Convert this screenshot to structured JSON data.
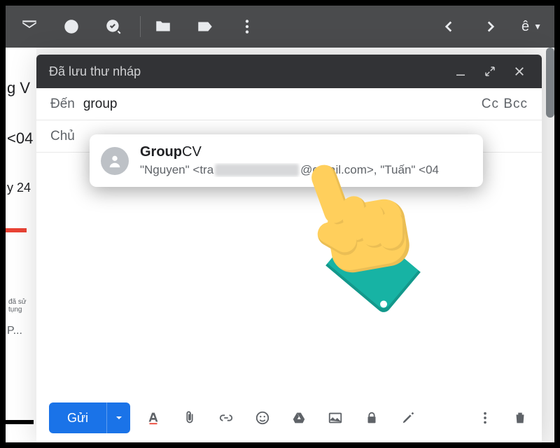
{
  "toolbar": {
    "account_letter": "ê"
  },
  "background": {
    "title_frag": "g V",
    "chip_frag": "<04",
    "date_frag": "y 24",
    "misc_frag": "đã sử tụng",
    "p_frag": "P..."
  },
  "compose": {
    "header_title": "Đã lưu thư nháp",
    "to_label": "Đến",
    "to_value": "group",
    "cc_label": "Cc",
    "bcc_label": "Bcc",
    "subject_label": "Chủ",
    "send_label": "Gửi"
  },
  "suggestion": {
    "name_bold": "Group",
    "name_rest": "CV",
    "members_pre": "\"Nguyen\" <tra",
    "members_mid": "@gmail.com>, \"Tuấn\" <04"
  }
}
